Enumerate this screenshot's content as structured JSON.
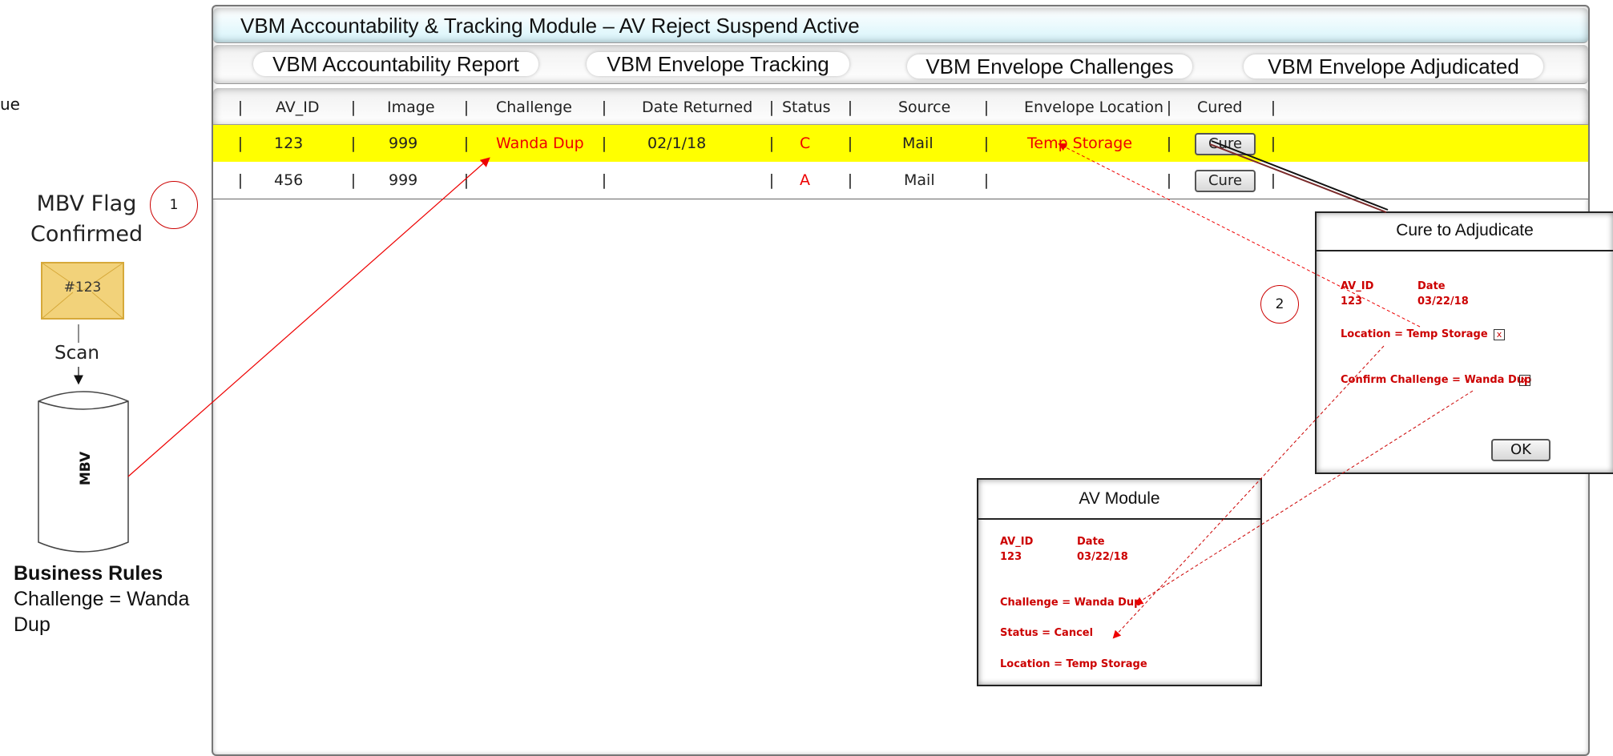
{
  "left_panel": {
    "cut_text": "ue",
    "flag_line1": "MBV Flag",
    "flag_line2": "Confirmed",
    "step1": "1",
    "envelope_label": "#123",
    "scan_label": "Scan",
    "db_label": "MBV",
    "rules_title": "Business Rules",
    "rules_line1": "Challenge = Wanda",
    "rules_line2": "Dup"
  },
  "window": {
    "title": "VBM Accountability & Tracking Module – AV Reject Suspend Active"
  },
  "tabs": [
    {
      "label": "VBM Accountability Report"
    },
    {
      "label": "VBM Envelope Tracking"
    },
    {
      "label": "VBM Envelope Challenges"
    },
    {
      "label": "VBM Envelope Adjudicated"
    }
  ],
  "table": {
    "columns": [
      "AV_ID",
      "Image",
      "Challenge",
      "Date Returned",
      "Status",
      "Source",
      "Envelope Location",
      "Cured"
    ],
    "rows": [
      {
        "av_id": "123",
        "image": "999",
        "challenge": "Wanda Dup",
        "date_returned": "02/1/18",
        "status": "C",
        "source": "Mail",
        "location": "Temp Storage",
        "cured": "Cure"
      },
      {
        "av_id": "456",
        "image": "999",
        "challenge": "",
        "date_returned": "",
        "status": "A",
        "source": "Mail",
        "location": "",
        "cured": "Cure"
      }
    ]
  },
  "cure_dialog": {
    "title": "Cure to Adjudicate",
    "av_id_label": "AV_ID",
    "date_label": "Date",
    "av_id": "123",
    "date": "03/22/18",
    "location": "Location  = Temp Storage",
    "confirm": "Confirm Challenge = Wanda Dup",
    "x": "x",
    "ok": "OK",
    "step2": "2"
  },
  "av_dialog": {
    "title": "AV Module",
    "av_id_label": "AV_ID",
    "date_label": "Date",
    "av_id": "123",
    "date": "03/22/18",
    "challenge": "Challenge  = Wanda Dup",
    "status": "Status = Cancel",
    "location": "Location = Temp Storage"
  },
  "colors": {
    "highlight_row": "#ffff00",
    "annotation_red": "#cc0000",
    "envelope": "#f2d27a"
  }
}
